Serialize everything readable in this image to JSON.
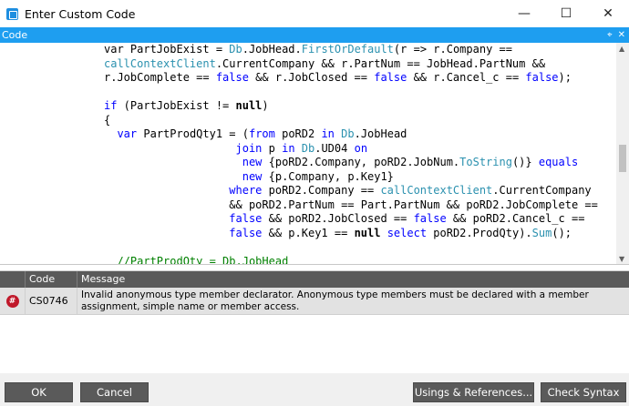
{
  "window": {
    "title": "Enter Custom Code",
    "minimize_glyph": "—",
    "maximize_glyph": "☐",
    "close_glyph": "✕"
  },
  "panel": {
    "header": "Code",
    "pin_glyph": "⌖",
    "close_glyph": "✕"
  },
  "code_lines": [
    [
      [
        "",
        "var PartJobExist = "
      ],
      [
        "cls",
        "Db"
      ],
      [
        "",
        ".JobHead."
      ],
      [
        "cls",
        "FirstOrDefault"
      ],
      [
        "",
        "(r => r.Company =="
      ]
    ],
    [
      [
        "cls",
        "callContextClient"
      ],
      [
        "",
        ".CurrentCompany && r.PartNum == JobHead.PartNum &&"
      ]
    ],
    [
      [
        "",
        "r.JobComplete == "
      ],
      [
        "kw",
        "false"
      ],
      [
        "",
        " && r.JobClosed == "
      ],
      [
        "kw",
        "false"
      ],
      [
        "",
        " && r.Cancel_c == "
      ],
      [
        "kw",
        "false"
      ],
      [
        "",
        ");"
      ]
    ],
    [
      [
        "",
        ""
      ]
    ],
    [
      [
        "kw",
        "if"
      ],
      [
        "",
        " (PartJobExist != "
      ],
      [
        "kb",
        "null"
      ],
      [
        "",
        ")"
      ]
    ],
    [
      [
        "",
        "{"
      ]
    ],
    [
      [
        "",
        "  "
      ],
      [
        "kw",
        "var"
      ],
      [
        "",
        " PartProdQty1 = ("
      ],
      [
        "kw",
        "from"
      ],
      [
        "",
        " poRD2 "
      ],
      [
        "kw",
        "in"
      ],
      [
        "",
        " "
      ],
      [
        "cls",
        "Db"
      ],
      [
        "",
        ".JobHead"
      ]
    ],
    [
      [
        "",
        "                    "
      ],
      [
        "kw",
        "join"
      ],
      [
        "",
        " p "
      ],
      [
        "kw",
        "in"
      ],
      [
        "",
        " "
      ],
      [
        "cls",
        "Db"
      ],
      [
        "",
        ".UD04 "
      ],
      [
        "kw",
        "on"
      ]
    ],
    [
      [
        "",
        "                     "
      ],
      [
        "kw",
        "new"
      ],
      [
        "",
        " {poRD2.Company, poRD2.JobNum."
      ],
      [
        "cls",
        "ToString"
      ],
      [
        "",
        "()} "
      ],
      [
        "kw",
        "equals"
      ]
    ],
    [
      [
        "",
        "                     "
      ],
      [
        "kw",
        "new"
      ],
      [
        "",
        " {p.Company, p.Key1}"
      ]
    ],
    [
      [
        "",
        "                   "
      ],
      [
        "kw",
        "where"
      ],
      [
        "",
        " poRD2.Company == "
      ],
      [
        "cls",
        "callContextClient"
      ],
      [
        "",
        ".CurrentCompany"
      ]
    ],
    [
      [
        "",
        "                   && poRD2.PartNum == Part.PartNum && poRD2.JobComplete =="
      ]
    ],
    [
      [
        "",
        "                   "
      ],
      [
        "kw",
        "false"
      ],
      [
        "",
        " && poRD2.JobClosed == "
      ],
      [
        "kw",
        "false"
      ],
      [
        "",
        " && poRD2.Cancel_c =="
      ]
    ],
    [
      [
        "",
        "                   "
      ],
      [
        "kw",
        "false"
      ],
      [
        "",
        " && p.Key1 == "
      ],
      [
        "kb",
        "null"
      ],
      [
        "",
        " "
      ],
      [
        "kw",
        "select"
      ],
      [
        "",
        " poRD2.ProdQty)."
      ],
      [
        "cls",
        "Sum"
      ],
      [
        "",
        "();"
      ]
    ],
    [
      [
        "",
        ""
      ]
    ],
    [
      [
        "",
        "  "
      ],
      [
        "cm",
        "//PartProdQty = Db.JobHead"
      ]
    ]
  ],
  "errors": {
    "columns": [
      "",
      "Code",
      "Message"
    ],
    "rows": [
      {
        "icon": "#",
        "code": "CS0746",
        "message": "Invalid anonymous type member declarator. Anonymous type members must be declared with a member assignment, simple name or member access."
      }
    ]
  },
  "buttons": {
    "ok": "OK",
    "cancel": "Cancel",
    "usings": "Usings & References...",
    "check": "Check Syntax"
  },
  "colors": {
    "accent": "#1e9ef0",
    "keyword": "#0000ff",
    "type": "#2b91af",
    "comment": "#008000",
    "error": "#c0182a",
    "button": "#5a5a5a"
  }
}
